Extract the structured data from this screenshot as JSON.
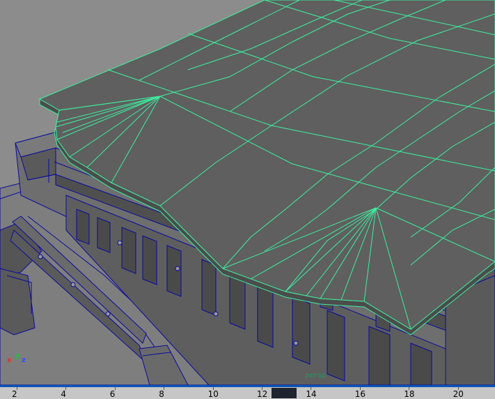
{
  "viewport": {
    "camera": "persp",
    "axis_indicator": {
      "x": "x",
      "y": "y",
      "z": "z"
    },
    "colors": {
      "background": "#8c8c8c",
      "selected_wireframe": "#3cf0a0",
      "unselected_wireframe": "#0a0aa0",
      "surface": "#5f5f5f"
    }
  },
  "timeline": {
    "labels": [
      "2",
      "4",
      "6",
      "8",
      "10",
      "12",
      "14",
      "16",
      "18",
      "20"
    ],
    "current_frame": 13,
    "colors": {
      "bar": "#c6c6c6",
      "border": "#0a55b8",
      "current": "#1e2430"
    }
  }
}
